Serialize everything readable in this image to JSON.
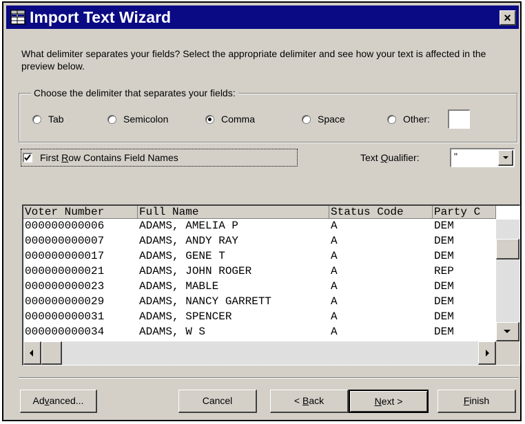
{
  "dialog": {
    "title": "Import Text Wizard",
    "title_icon": "table-icon",
    "close_glyph": "×",
    "prompt": "What delimiter separates your fields?  Select the appropriate delimiter and see how your text is affected in the preview below."
  },
  "delimiter": {
    "group_label": "Choose the delimiter that separates your fields:",
    "options": [
      {
        "label": "Tab",
        "selected": false
      },
      {
        "label": "Semicolon",
        "selected": false
      },
      {
        "label": "Comma",
        "selected": true
      },
      {
        "label": "Space",
        "selected": false
      },
      {
        "label": "Other:",
        "selected": false
      }
    ],
    "other_value": ""
  },
  "first_row": {
    "label_pre": "First ",
    "label_key": "R",
    "label_post": "ow Contains Field Names",
    "checked": true
  },
  "text_qualifier": {
    "label_pre": "Text ",
    "label_key": "Q",
    "label_post": "ualifier:",
    "value": "\""
  },
  "preview": {
    "columns": [
      "Voter Number",
      "Full Name",
      "Status Code",
      "Party C"
    ],
    "rows": [
      [
        "000000000006",
        "ADAMS, AMELIA P",
        "A",
        "DEM"
      ],
      [
        "000000000007",
        "ADAMS, ANDY RAY",
        "A",
        "DEM"
      ],
      [
        "000000000017",
        "ADAMS, GENE T",
        "A",
        "DEM"
      ],
      [
        "000000000021",
        "ADAMS, JOHN ROGER",
        "A",
        "REP"
      ],
      [
        "000000000023",
        "ADAMS, MABLE",
        "A",
        "DEM"
      ],
      [
        "000000000029",
        "ADAMS, NANCY GARRETT",
        "A",
        "DEM"
      ],
      [
        "000000000031",
        "ADAMS, SPENCER",
        "A",
        "DEM"
      ],
      [
        "000000000034",
        "ADAMS, W S",
        "A",
        "DEM"
      ]
    ]
  },
  "buttons": {
    "advanced": {
      "pre": "Ad",
      "key": "v",
      "post": "anced..."
    },
    "cancel": {
      "pre": "",
      "key": "",
      "post": "Cancel"
    },
    "back": {
      "pre": "< ",
      "key": "B",
      "post": "ack"
    },
    "next": {
      "pre": "",
      "key": "N",
      "post": "ext >"
    },
    "finish": {
      "pre": "",
      "key": "F",
      "post": "inish"
    }
  },
  "colors": {
    "titlebar": "#0a0a84",
    "face": "#d4d0c8"
  }
}
